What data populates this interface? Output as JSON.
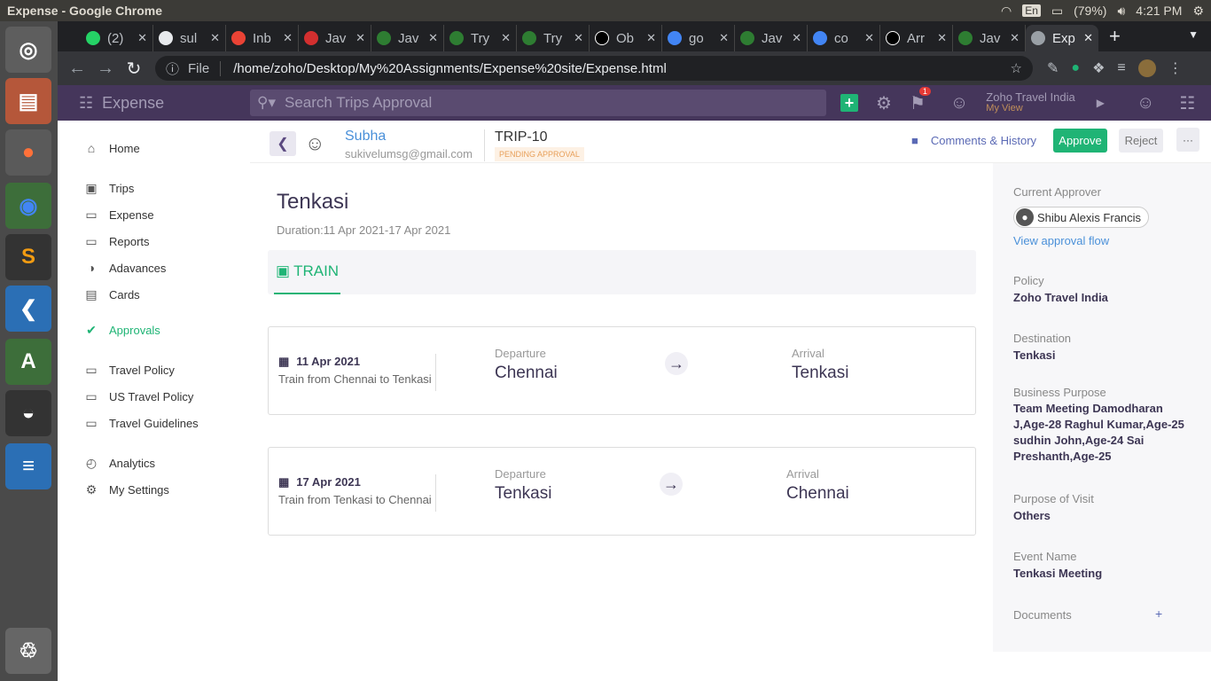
{
  "os": {
    "window_title": "Expense - Google Chrome",
    "lang": "En",
    "battery": "(79%)",
    "time": "4:21 PM"
  },
  "browser": {
    "tabs": [
      {
        "label": "(2)",
        "color": "#25d366"
      },
      {
        "label": "sul",
        "color": "#e8eaed"
      },
      {
        "label": "Inb",
        "color": "#ea4335"
      },
      {
        "label": "Jav",
        "color": "#d32f2f"
      },
      {
        "label": "Jav",
        "color": "#2e7d32"
      },
      {
        "label": "Try",
        "color": "#2e7d32"
      },
      {
        "label": "Try",
        "color": "#2e7d32"
      },
      {
        "label": "Ob",
        "color": "#000000"
      },
      {
        "label": "go",
        "color": "#4285f4"
      },
      {
        "label": "Jav",
        "color": "#2e7d32"
      },
      {
        "label": "co",
        "color": "#4285f4"
      },
      {
        "label": "Arr",
        "color": "#000000"
      },
      {
        "label": "Jav",
        "color": "#2e7d32"
      },
      {
        "label": "Exp",
        "color": "#9aa0a6"
      }
    ],
    "url_scheme": "File",
    "url": "/home/zoho/Desktop/My%20Assignments/Expense%20site/Expense.html"
  },
  "app": {
    "name": "Expense",
    "search_placeholder": "Search Trips Approval",
    "notifications": "1",
    "org_name": "Zoho Travel India",
    "org_view": "My View"
  },
  "sidebar": {
    "home": "Home",
    "trips": "Trips",
    "expense": "Expense",
    "reports": "Reports",
    "advances": "Adavances",
    "cards": "Cards",
    "approvals": "Approvals",
    "travel_policy": "Travel Policy",
    "us_travel_policy": "US Travel Policy",
    "travel_guidelines": "Travel Guidelines",
    "analytics": "Analytics",
    "my_settings": "My Settings"
  },
  "trip": {
    "user_name": "Subha",
    "user_email": "sukivelumsg@gmail.com",
    "trip_id": "TRIP-10",
    "status": "PENDING APPROVAL",
    "comments_label": "Comments & History",
    "approve_label": "Approve",
    "reject_label": "Reject",
    "more_label": "···",
    "destination": "Tenkasi",
    "duration": "Duration:11 Apr 2021-17 Apr 2021",
    "mode": "TRAIN",
    "legs": [
      {
        "date": "11 Apr 2021",
        "desc": "Train from Chennai to Tenkasi",
        "dep_label": "Departure",
        "dep_city": "Chennai",
        "arr_label": "Arrival",
        "arr_city": "Tenkasi"
      },
      {
        "date": "17 Apr 2021",
        "desc": "Train from Tenkasi to Chennai",
        "dep_label": "Departure",
        "dep_city": "Tenkasi",
        "arr_label": "Arrival",
        "arr_city": "Chennai"
      }
    ]
  },
  "details": {
    "current_approver_label": "Current Approver",
    "current_approver": "Shibu Alexis Francis",
    "view_flow": "View approval flow",
    "policy_label": "Policy",
    "policy": "Zoho Travel India",
    "destination_label": "Destination",
    "destination": "Tenkasi",
    "business_purpose_label": "Business Purpose",
    "business_purpose": "Team Meeting Damodharan J,Age-28 Raghul Kumar,Age-25 sudhin John,Age-24 Sai Preshanth,Age-25",
    "purpose_visit_label": "Purpose of Visit",
    "purpose_visit": "Others",
    "event_name_label": "Event Name",
    "event_name": "Tenkasi Meeting",
    "documents_label": "Documents"
  },
  "colors": {
    "accent": "#1fb475",
    "header": "#45365b",
    "link": "#4a90d9"
  }
}
